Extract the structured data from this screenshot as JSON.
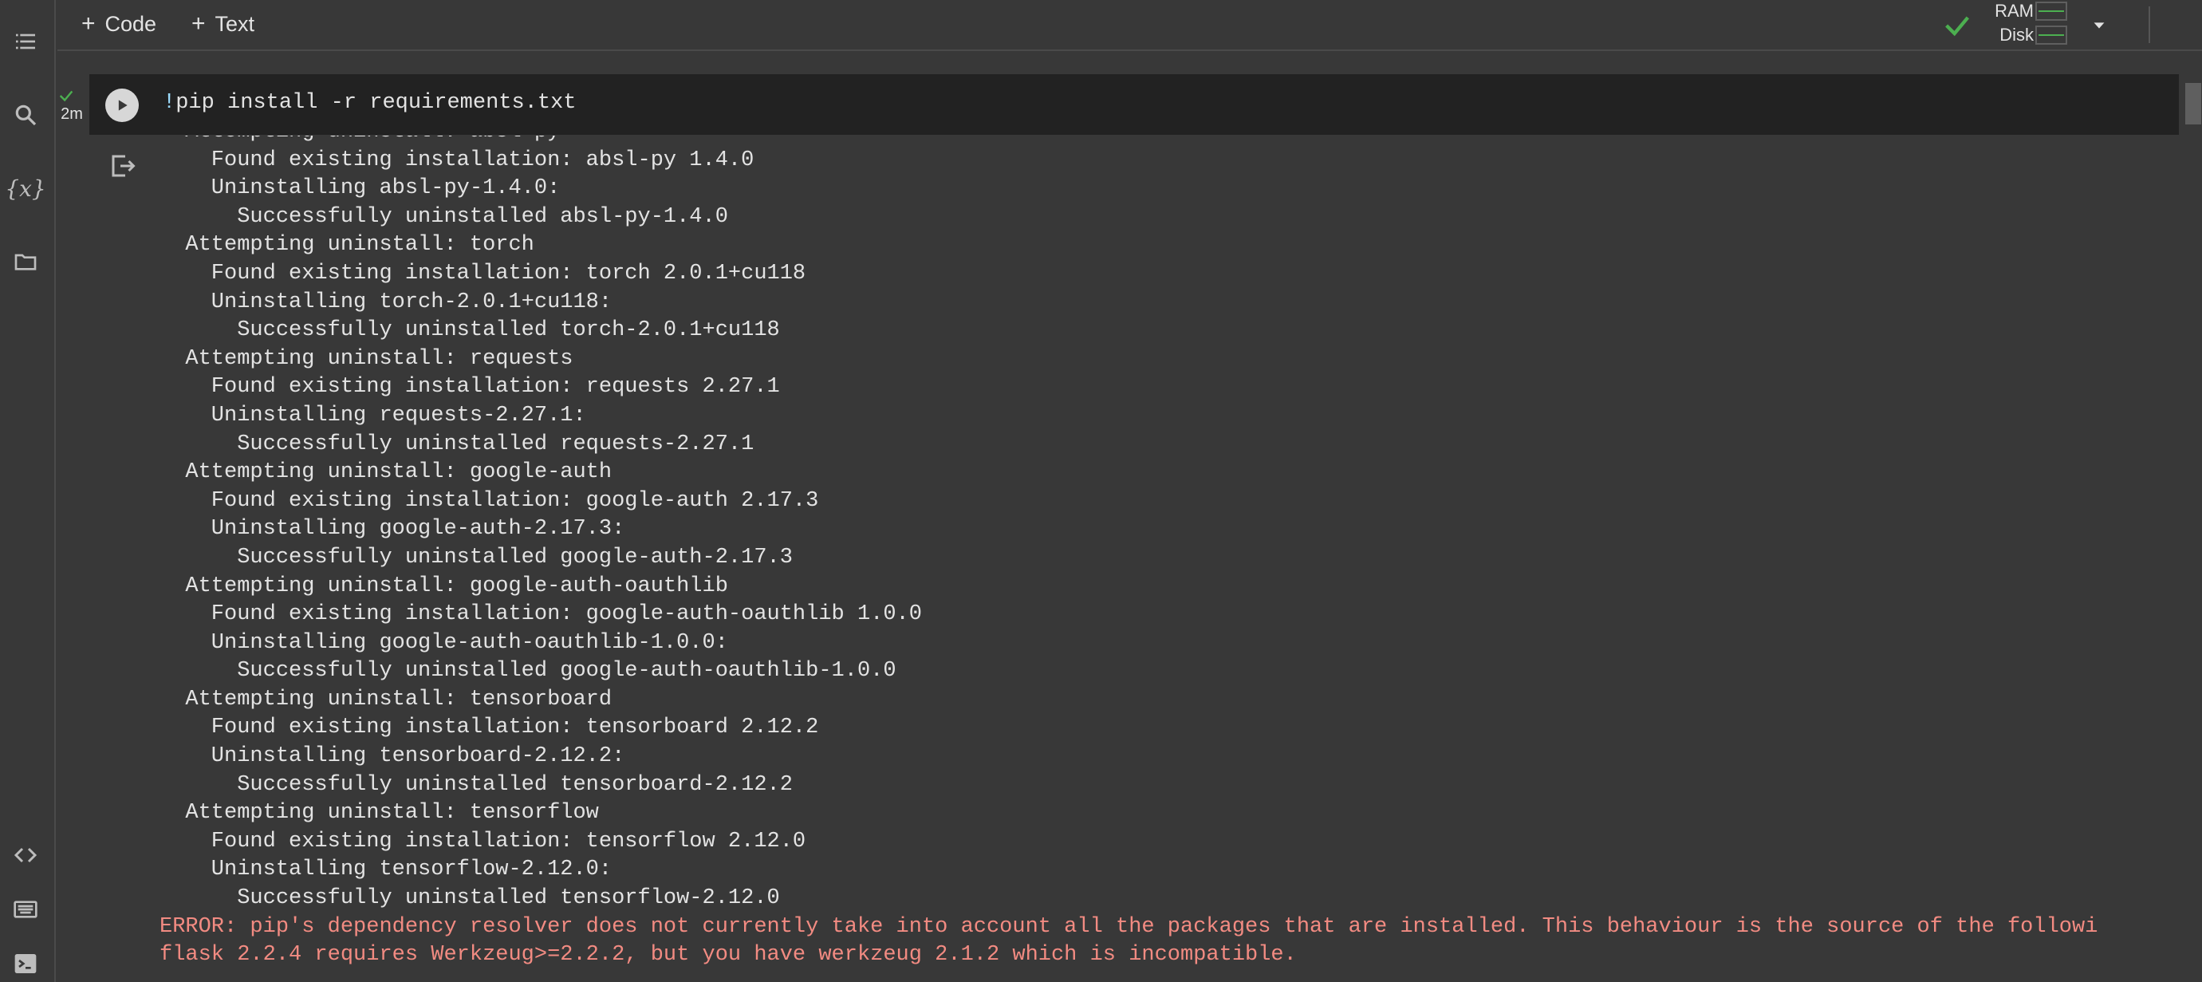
{
  "toolbar": {
    "add_code_label": "Code",
    "add_text_label": "Text",
    "ram_label": "RAM",
    "disk_label": "Disk",
    "runtime_status": "connected"
  },
  "sidebar": {
    "icons": [
      "table-of-contents-icon",
      "search-icon",
      "variables-icon",
      "files-icon",
      "code-snippets-icon",
      "command-palette-icon",
      "terminal-icon"
    ]
  },
  "cell": {
    "exec_time": "2m",
    "code": "!pip install -r requirements.txt"
  },
  "output": {
    "clipped_first_line": "  Attempting uninstall: absl-py",
    "lines": [
      "    Found existing installation: absl-py 1.4.0",
      "    Uninstalling absl-py-1.4.0:",
      "      Successfully uninstalled absl-py-1.4.0",
      "  Attempting uninstall: torch",
      "    Found existing installation: torch 2.0.1+cu118",
      "    Uninstalling torch-2.0.1+cu118:",
      "      Successfully uninstalled torch-2.0.1+cu118",
      "  Attempting uninstall: requests",
      "    Found existing installation: requests 2.27.1",
      "    Uninstalling requests-2.27.1:",
      "      Successfully uninstalled requests-2.27.1",
      "  Attempting uninstall: google-auth",
      "    Found existing installation: google-auth 2.17.3",
      "    Uninstalling google-auth-2.17.3:",
      "      Successfully uninstalled google-auth-2.17.3",
      "  Attempting uninstall: google-auth-oauthlib",
      "    Found existing installation: google-auth-oauthlib 1.0.0",
      "    Uninstalling google-auth-oauthlib-1.0.0:",
      "      Successfully uninstalled google-auth-oauthlib-1.0.0",
      "  Attempting uninstall: tensorboard",
      "    Found existing installation: tensorboard 2.12.2",
      "    Uninstalling tensorboard-2.12.2:",
      "      Successfully uninstalled tensorboard-2.12.2",
      "  Attempting uninstall: tensorflow",
      "    Found existing installation: tensorflow 2.12.0",
      "    Uninstalling tensorflow-2.12.0:",
      "      Successfully uninstalled tensorflow-2.12.0"
    ],
    "error_lines": [
      "ERROR: pip's dependency resolver does not currently take into account all the packages that are installed. This behaviour is the source of the followi",
      "flask 2.2.4 requires Werkzeug>=2.2.2, but you have werkzeug 2.1.2 which is incompatible."
    ]
  },
  "colors": {
    "background": "#383838",
    "editor_bg": "#222222",
    "error_text": "#f28b82",
    "ok_green": "#4caf50"
  }
}
